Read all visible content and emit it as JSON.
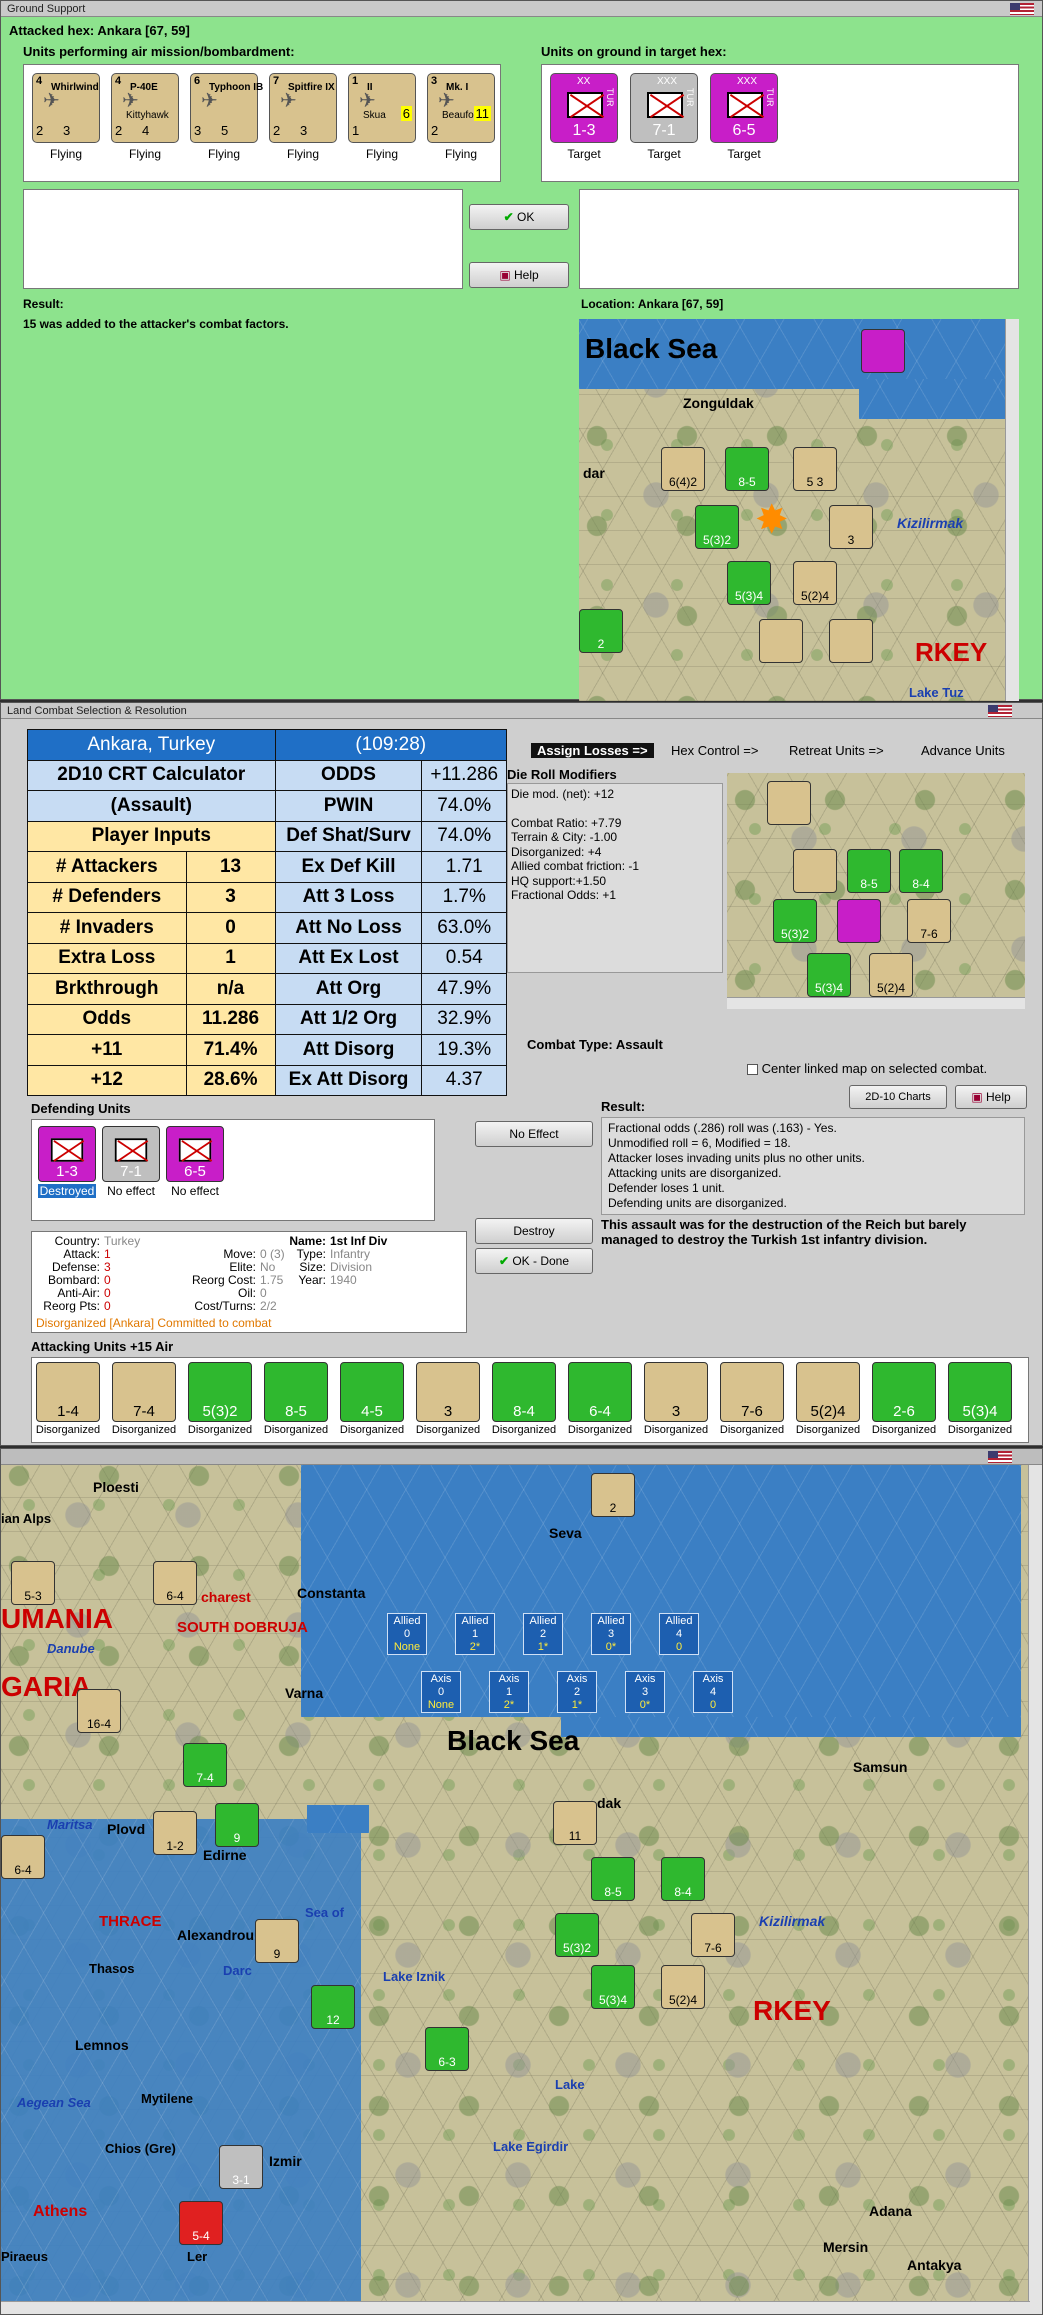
{
  "ground_support": {
    "title": "Ground Support",
    "attacked_hex": "Attacked hex: Ankara  [67, 59]",
    "air_units_label": "Units performing air mission/bombardment:",
    "ground_units_label": "Units on ground in target hex:",
    "air_units": [
      {
        "top_left": "4",
        "name": "Whirlwind",
        "att": "2",
        "def": "3",
        "status": "Flying"
      },
      {
        "top_left": "4",
        "name": "P-40E",
        "sub": "Kittyhawk",
        "att": "2",
        "def": "4",
        "status": "Flying"
      },
      {
        "top_left": "6",
        "name": "Typhoon IB",
        "att": "3",
        "def": "5",
        "status": "Flying"
      },
      {
        "top_left": "7",
        "name": "Spitfire IX",
        "att": "2",
        "def": "3",
        "status": "Flying"
      },
      {
        "top_left": "1",
        "name": "II",
        "sub": "Skua",
        "mid": "6",
        "att": "1",
        "def": "",
        "status": "Flying"
      },
      {
        "top_left": "3",
        "name": "Mk. I",
        "sub": "Beaufort",
        "mid": "11",
        "att": "2",
        "def": "",
        "status": "Flying"
      }
    ],
    "target_units": [
      {
        "size": "XX",
        "nation": "TUR",
        "value": "1-3",
        "status": "Target"
      },
      {
        "size": "XXX",
        "nation": "TUR",
        "value": "7-1",
        "status": "Target"
      },
      {
        "size": "XXX",
        "nation": "TUR",
        "value": "6-5",
        "status": "Target"
      }
    ],
    "ok_label": "OK",
    "help_label": "Help",
    "result_label": "Result:",
    "result_text": "15 was added to the attacker's combat factors.",
    "location_label": "Location:  Ankara  [67, 59]",
    "minimap": {
      "sea": "Black Sea",
      "city1": "Zonguldak",
      "river": "Kizilirmak",
      "country": "RKEY",
      "lake": "Lake Tuz",
      "edge": "dar"
    }
  },
  "land_combat": {
    "title": "Land Combat Selection & Resolution",
    "crt": {
      "header_left": "Ankara, Turkey",
      "header_right": "(109:28)",
      "rows": [
        [
          "2D10 CRT Calculator",
          "",
          "ODDS",
          "+11.286"
        ],
        [
          "(Assault)",
          "",
          "PWIN",
          "74.0%"
        ],
        [
          "Player Inputs",
          "",
          "Def Shat/Surv",
          "74.0%"
        ],
        [
          "# Attackers",
          "13",
          "Ex Def Kill",
          "1.71"
        ],
        [
          "# Defenders",
          "3",
          "Att 3 Loss",
          "1.7%"
        ],
        [
          "# Invaders",
          "0",
          "Att No Loss",
          "63.0%"
        ],
        [
          "Extra Loss",
          "1",
          "Att Ex Lost",
          "0.54"
        ],
        [
          "Brkthrough",
          "n/a",
          "Att Org",
          "47.9%"
        ],
        [
          "Odds",
          "11.286",
          "Att 1/2 Org",
          "32.9%"
        ],
        [
          "+11",
          "71.4%",
          "Att Disorg",
          "19.3%"
        ],
        [
          "+12",
          "28.6%",
          "Ex Att Disorg",
          "4.37"
        ]
      ]
    },
    "tabs": [
      "Assign Losses =>",
      "Hex Control =>",
      "Retreat Units =>",
      "Advance Units"
    ],
    "die_roll_title": "Die Roll Modifiers",
    "die_roll_lines": [
      "Die mod. (net): +12",
      "",
      "Combat Ratio: +7.79",
      "Terrain & City: -1.00",
      "Disorganized: +4",
      "Allied combat friction: -1",
      "HQ support:+1.50",
      "Fractional Odds: +1"
    ],
    "combat_type": "Combat Type:  Assault",
    "center_checkbox": "Center linked map on selected combat.",
    "charts_button": "2D-10 Charts",
    "help_button": "Help",
    "defending_label": "Defending Units",
    "defenders": [
      {
        "value": "1-3",
        "status": "Destroyed"
      },
      {
        "value": "7-1",
        "status": "No effect"
      },
      {
        "value": "6-5",
        "status": "No effect"
      }
    ],
    "no_effect_button": "No Effect",
    "destroy_button": "Destroy",
    "ok_done_button": "OK - Done",
    "result_label": "Result:",
    "result_lines": [
      "Fractional odds (.286) roll was (.163)  - Yes.",
      "Unmodified roll = 6, Modified = 18.",
      "Attacker loses invading units plus no other units.",
      "Attacking units are disorganized.",
      "Defender loses 1 unit.",
      "Defending units are disorganized."
    ],
    "result_bold": "This assault was for the destruction of the Reich but barely managed to destroy the Turkish 1st infantry division.",
    "unit_info": {
      "country_label": "Country:",
      "country": "Turkey",
      "attack_label": "Attack:",
      "attack": "1",
      "defense_label": "Defense:",
      "defense": "3",
      "bombard_label": "Bombard:",
      "bombard": "0",
      "antiair_label": "Anti-Air:",
      "antiair": "0",
      "reorg_label": "Reorg Pts:",
      "reorg": "0",
      "name_label": "Name:",
      "name": "1st Inf Div",
      "move_label": "Move:",
      "move": "0 (3)",
      "type_label": "Type:",
      "type": "Infantry",
      "elite_label": "Elite:",
      "elite": "No",
      "size_label": "Size:",
      "size": "Division",
      "reorg_cost_label": "Reorg Cost:",
      "reorg_cost": "1.75",
      "year_label": "Year:",
      "year": "1940",
      "oil_label": "Oil:",
      "oil": "0",
      "cost_label": "Cost/Turns:",
      "cost": "2/2",
      "status_line": "Disorganized [Ankara] Committed to combat"
    },
    "attacking_label": "Attacking Units +15 Air",
    "attackers": [
      {
        "value": "1-4",
        "status": "Disorganized"
      },
      {
        "value": "7-4",
        "status": "Disorganized"
      },
      {
        "value": "5(3)2",
        "status": "Disorganized"
      },
      {
        "value": "8-5",
        "status": "Disorganized"
      },
      {
        "value": "4-5",
        "status": "Disorganized"
      },
      {
        "value": "3",
        "status": "Disorganized"
      },
      {
        "value": "8-4",
        "status": "Disorganized"
      },
      {
        "value": "6-4",
        "status": "Disorganized"
      },
      {
        "value": "3",
        "status": "Disorganized"
      },
      {
        "value": "7-6",
        "status": "Disorganized"
      },
      {
        "value": "5(2)4",
        "status": "Disorganized"
      },
      {
        "value": "2-6",
        "status": "Disorganized"
      },
      {
        "value": "5(3)4",
        "status": "Disorganized"
      }
    ]
  },
  "main_map": {
    "labels": {
      "ploesti": "Ploesti",
      "alps": "ian Alps",
      "constanta": "Constanta",
      "rumania": "UMANIA",
      "dobruja": "SOUTH DOBRUJA",
      "charest": "charest",
      "danube": "Danube",
      "varna": "Varna",
      "garia": "GARIA",
      "sevastopol": "Seva",
      "black_sea": "Black Sea",
      "samsun": "Samsun",
      "plovdiv": "Plovd",
      "edirne": "Edirne",
      "maritsa": "Maritsa",
      "thrace": "THRACE",
      "alexandroupolis": "Alexandroupolis",
      "thasos": "Thasos",
      "sea_of": "Sea of",
      "lake_iznik": "Lake Iznik",
      "kizilirmak": "Kizilirmak",
      "dak": "dak",
      "lemnos": "Lemnos",
      "mytilene": "Mytilene",
      "aegean": "Aegean Sea",
      "chios": "Chios (Gre)",
      "izmir": "Izmir",
      "lake_egirdir": "Lake Egirdir",
      "athens": "Athens",
      "piraeus": "Piraeus",
      "adana": "Adana",
      "mersin": "Mersin",
      "antakya": "Antakya",
      "ler": "Ler",
      "rkey": "RKEY",
      "darc": "Darc",
      "lake": "Lake"
    },
    "allied_boxes": [
      {
        "label": "Allied",
        "n": "0",
        "v": "None"
      },
      {
        "label": "Allied",
        "n": "1",
        "v": "2*"
      },
      {
        "label": "Allied",
        "n": "2",
        "v": "1*"
      },
      {
        "label": "Allied",
        "n": "3",
        "v": "0*"
      },
      {
        "label": "Allied",
        "n": "4",
        "v": "0"
      }
    ],
    "axis_boxes": [
      {
        "label": "Axis",
        "n": "0",
        "v": "None"
      },
      {
        "label": "Axis",
        "n": "1",
        "v": "2*"
      },
      {
        "label": "Axis",
        "n": "2",
        "v": "1*"
      },
      {
        "label": "Axis",
        "n": "3",
        "v": "0*"
      },
      {
        "label": "Axis",
        "n": "4",
        "v": "0"
      }
    ],
    "counters": [
      {
        "v": "5-3"
      },
      {
        "v": "6-4"
      },
      {
        "v": "16-4"
      },
      {
        "v": "7-4"
      },
      {
        "v": "1-2"
      },
      {
        "v": "9"
      },
      {
        "v": "6-4"
      },
      {
        "v": "8-5"
      },
      {
        "v": "8-4"
      },
      {
        "v": "5(3)2"
      },
      {
        "v": "7-6"
      },
      {
        "v": "5(3)4"
      },
      {
        "v": "5(2)4"
      },
      {
        "v": "6-3"
      },
      {
        "v": "3-1"
      },
      {
        "v": "5-4"
      },
      {
        "v": "12"
      },
      {
        "v": "2"
      },
      {
        "v": "11"
      },
      {
        "v": "9"
      }
    ]
  },
  "colors": {
    "panel_green": "#8de38d",
    "hex_terrain": "#c7c19a",
    "sea": "#3b7fc4",
    "axis_red": "#e02020",
    "allied_green": "#2fb82f",
    "turkey_magenta": "#c81ec8"
  }
}
